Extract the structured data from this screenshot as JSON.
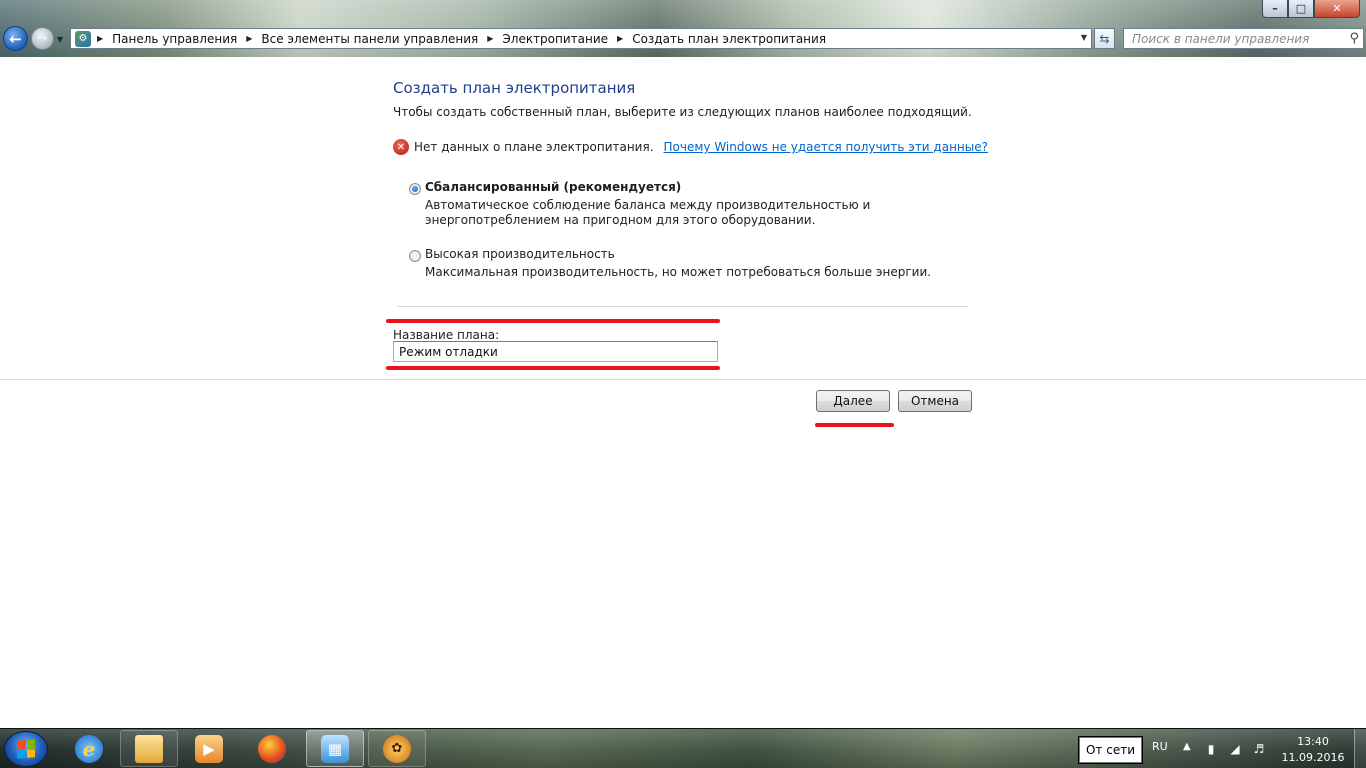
{
  "window": {
    "minimize": "–",
    "maximize": "□",
    "close": "✕"
  },
  "address": {
    "breadcrumbs": [
      "Панель управления",
      "Все элементы панели управления",
      "Электропитание",
      "Создать план электропитания"
    ]
  },
  "search": {
    "placeholder": "Поиск в панели управления"
  },
  "page": {
    "title": "Создать план электропитания",
    "intro": "Чтобы создать собственный план, выберите из следующих планов наиболее подходящий.",
    "error_text": "Нет данных о плане электропитания.",
    "error_link": "Почему Windows не удается получить эти данные?",
    "plans": [
      {
        "label": "Сбалансированный (рекомендуется)",
        "desc": "Автоматическое соблюдение баланса между производительностью и энергопотреблением на пригодном для этого оборудовании.",
        "selected": true
      },
      {
        "label": "Высокая производительность",
        "desc": "Максимальная производительность, но может потребоваться больше энергии.",
        "selected": false
      }
    ],
    "plan_name_label": "Название плана:",
    "plan_name_value": "Режим отладки",
    "next_button": "Далее",
    "cancel_button": "Отмена"
  },
  "taskbar": {
    "apps": [
      "internet-explorer",
      "windows-explorer",
      "media-center",
      "firefox",
      "control-panel",
      "xnview"
    ],
    "tooltip": "От сети",
    "language": "RU",
    "time": "13:40",
    "date": "11.09.2016"
  },
  "colors": {
    "accent_red": "#e8141a",
    "title_blue": "#1e3e8c",
    "link_blue": "#0066cc"
  }
}
